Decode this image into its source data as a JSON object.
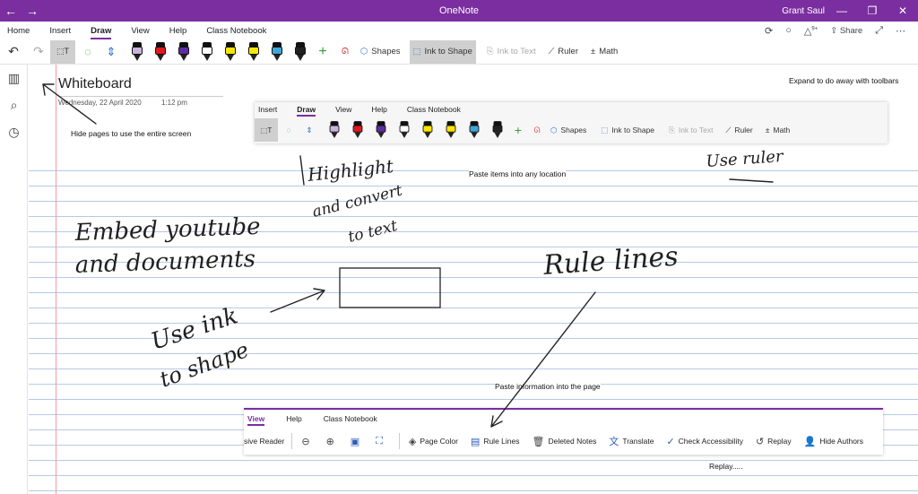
{
  "window": {
    "title": "OneNote",
    "user": "Grant Saul",
    "back_glyph": "←",
    "forward_glyph": "→",
    "controls": {
      "minimize": "—",
      "restore": "❐",
      "close": "✕"
    }
  },
  "ribbon": {
    "tabs": [
      "Home",
      "Insert",
      "Draw",
      "View",
      "Help",
      "Class Notebook"
    ],
    "active_tab": "Draw",
    "right": {
      "sync": "⟳",
      "idea": "💡",
      "notifications": "🔔",
      "notif_badge": "9+",
      "share": "Share",
      "expand": "⤢",
      "more": "⋯"
    },
    "tools": {
      "undo": "↶",
      "redo": "↷",
      "lasso": "⬚T",
      "lasso_select": "◌",
      "space": "⇕",
      "add_pen": "+",
      "shapes": "Shapes",
      "ink_to_shape": "Ink to Shape",
      "ink_to_text": "Ink to Text",
      "ruler": "Ruler",
      "math": "Math"
    },
    "pens": [
      {
        "color": "#c9b3df"
      },
      {
        "color": "#e0191e"
      },
      {
        "color": "#5e2ca5"
      },
      {
        "color": "#ffffff"
      },
      {
        "color": "#ffe600"
      },
      {
        "color": "#ffe600"
      },
      {
        "color": "#3ea6d8"
      },
      {
        "color": "#222222"
      }
    ]
  },
  "leftnav": {
    "notebooks": "▥",
    "search": "⌕",
    "recent": "◷"
  },
  "page": {
    "title": "Whiteboard",
    "date": "Wednesday, 22 April 2020",
    "time": "1:12 pm",
    "notes": {
      "expand": "Expand to do away with toolbars",
      "hide_pages": "Hide pages to use the entire screen",
      "paste_items": "Paste items into any location",
      "paste_info": "Paste information into the page",
      "replay": "Replay....."
    },
    "handwriting": {
      "highlight_1": "Highlight",
      "highlight_2": "and convert",
      "highlight_3": "to text",
      "embed_1": "Embed youtube",
      "embed_2": "and documents",
      "ink_1": "Use ink",
      "ink_2": "to shape",
      "rule_lines": "Rule lines",
      "use_ruler": "Use ruler"
    }
  },
  "snapshot_draw": {
    "tabs": [
      "Insert",
      "Draw",
      "View",
      "Help",
      "Class Notebook"
    ],
    "active_tab": "Draw",
    "shapes": "Shapes",
    "ink_to_shape": "Ink to Shape",
    "ink_to_text": "Ink to Text",
    "ruler": "Ruler",
    "math": "Math"
  },
  "snapshot_view": {
    "tabs": [
      "View",
      "Help",
      "Class Notebook"
    ],
    "active_tab": "View",
    "items": {
      "reader": "sive Reader",
      "page_color": "Page Color",
      "rule_lines": "Rule Lines",
      "deleted_notes": "Deleted Notes",
      "translate": "Translate",
      "check_accessibility": "Check Accessibility",
      "replay": "Replay",
      "hide_authors": "Hide Authors"
    }
  }
}
